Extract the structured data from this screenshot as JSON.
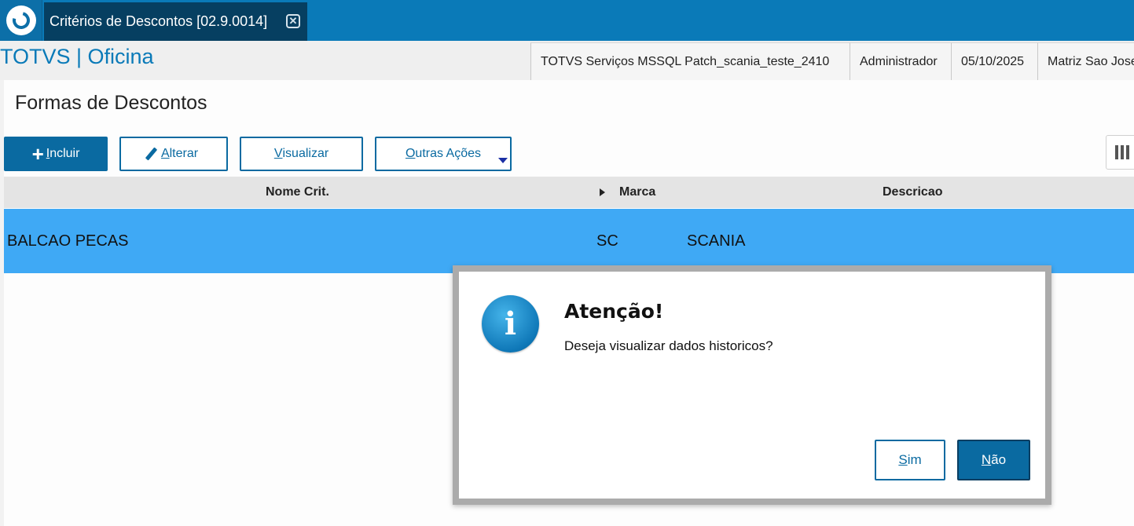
{
  "topbar": {
    "tab_title": "Critérios de Descontos [02.9.0014]",
    "tab_close_glyph": "✕"
  },
  "header": {
    "brand": "TOTVS | Oficina",
    "environment": "TOTVS Serviços MSSQL Patch_scania_teste_2410",
    "user": "Administrador",
    "date": "05/10/2025",
    "branch": "Matriz Sao Jose"
  },
  "page": {
    "title": "Formas de Descontos"
  },
  "toolbar": {
    "incluir_first": "I",
    "incluir_rest": "ncluir",
    "alterar_first": "A",
    "alterar_rest": "lterar",
    "visualizar_first": "V",
    "visualizar_rest": "isualizar",
    "outras_first": "O",
    "outras_rest": "utras Ações"
  },
  "grid": {
    "columns": [
      "Nome Crit.",
      "Marca",
      "Descricao"
    ],
    "rows": [
      {
        "nome": "BALCAO PECAS",
        "marca": "SC",
        "descricao": "SCANIA"
      }
    ]
  },
  "dialog": {
    "icon_glyph": "i",
    "title": "Atenção!",
    "message": "Deseja visualizar dados historicos?",
    "yes_first": "S",
    "yes_rest": "im",
    "no_first": "N",
    "no_rest": "ão"
  },
  "colors": {
    "accent": "#0a7ab8",
    "selected_row": "#3fa9f5",
    "button": "#0a6aa1"
  },
  "icons": {
    "logo": "totvs-logo-icon",
    "plus": "plus-icon",
    "pencil": "pencil-icon",
    "dropdown": "caret-down-icon",
    "columns": "columns-icon",
    "info": "info-icon"
  }
}
